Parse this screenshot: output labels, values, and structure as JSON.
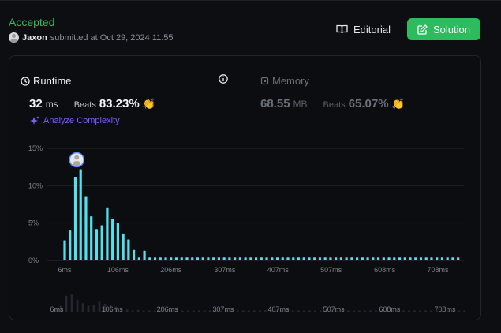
{
  "header": {
    "status": "Accepted",
    "user": "Jaxon",
    "submitted_text": "submitted at Oct 29, 2024 11:55",
    "editorial_label": "Editorial",
    "solution_label": "Solution"
  },
  "runtime": {
    "label": "Runtime",
    "value": "32",
    "unit": "ms",
    "beats_label": "Beats",
    "beats_pct": "83.23%",
    "analyze_label": "Analyze Complexity"
  },
  "memory": {
    "label": "Memory",
    "value": "68.55",
    "unit": "MB",
    "beats_label": "Beats",
    "beats_pct": "65.07%"
  },
  "colors": {
    "accepted": "#2cbb5d",
    "bar": "#4fe3f0",
    "analyze": "#7c5cff",
    "muted": "#6b6f77"
  },
  "chart_data": {
    "type": "bar",
    "title": "",
    "xlabel": "",
    "ylabel": "",
    "y_ticks": [
      "15%",
      "10%",
      "5%",
      "0%"
    ],
    "y_tick_values": [
      15,
      10,
      5,
      0
    ],
    "ylim": [
      0,
      15
    ],
    "x_tick_labels": [
      "6ms",
      "106ms",
      "206ms",
      "307ms",
      "407ms",
      "507ms",
      "608ms",
      "708ms"
    ],
    "x_tick_values": [
      6,
      106,
      206,
      307,
      407,
      507,
      608,
      708
    ],
    "xlim": [
      6,
      748
    ],
    "overview_ticks": [
      "6ms",
      "106ms",
      "206ms",
      "307ms",
      "407ms",
      "507ms",
      "608ms",
      "708ms"
    ],
    "bin_width_ms": 10,
    "x": [
      6,
      16,
      26,
      36,
      46,
      56,
      66,
      76,
      86,
      96,
      106,
      116,
      126,
      136,
      146,
      156,
      166,
      176,
      186,
      196,
      206,
      216,
      226,
      236,
      246,
      256,
      266,
      276,
      286,
      296,
      306,
      316,
      326,
      336,
      346,
      356,
      366,
      376,
      386,
      396,
      406,
      416,
      426,
      436,
      446,
      456,
      466,
      476,
      486,
      496,
      506,
      516,
      526,
      536,
      546,
      556,
      566,
      576,
      586,
      596,
      606,
      616,
      626,
      636,
      646,
      656,
      666,
      676,
      686,
      696,
      706,
      716,
      726,
      736,
      746
    ],
    "values": [
      2.7,
      4.0,
      11.2,
      12.2,
      8.5,
      5.9,
      4.2,
      4.7,
      7.1,
      5.6,
      5.0,
      3.6,
      2.8,
      1.4,
      0.4,
      1.3,
      0.4,
      0.4,
      0.4,
      0.4,
      0.4,
      0.4,
      0.4,
      0.4,
      0.4,
      0.4,
      0.4,
      0.4,
      0.4,
      0.4,
      0.4,
      0.4,
      0.4,
      0.4,
      0.4,
      0.4,
      0.4,
      0.4,
      0.4,
      0.4,
      0.4,
      0.4,
      0.4,
      0.4,
      0.4,
      0.4,
      0.4,
      0.4,
      0.4,
      0.4,
      0.4,
      0.4,
      0.4,
      0.4,
      0.4,
      0.4,
      0.4,
      0.4,
      0.4,
      0.4,
      0.4,
      0.4,
      0.4,
      0.4,
      0.4,
      0.4,
      0.4,
      0.4,
      0.4,
      0.4,
      0.4,
      0.4,
      0.4,
      0.4,
      0.4
    ],
    "highlight_x": 36,
    "grid": true
  }
}
